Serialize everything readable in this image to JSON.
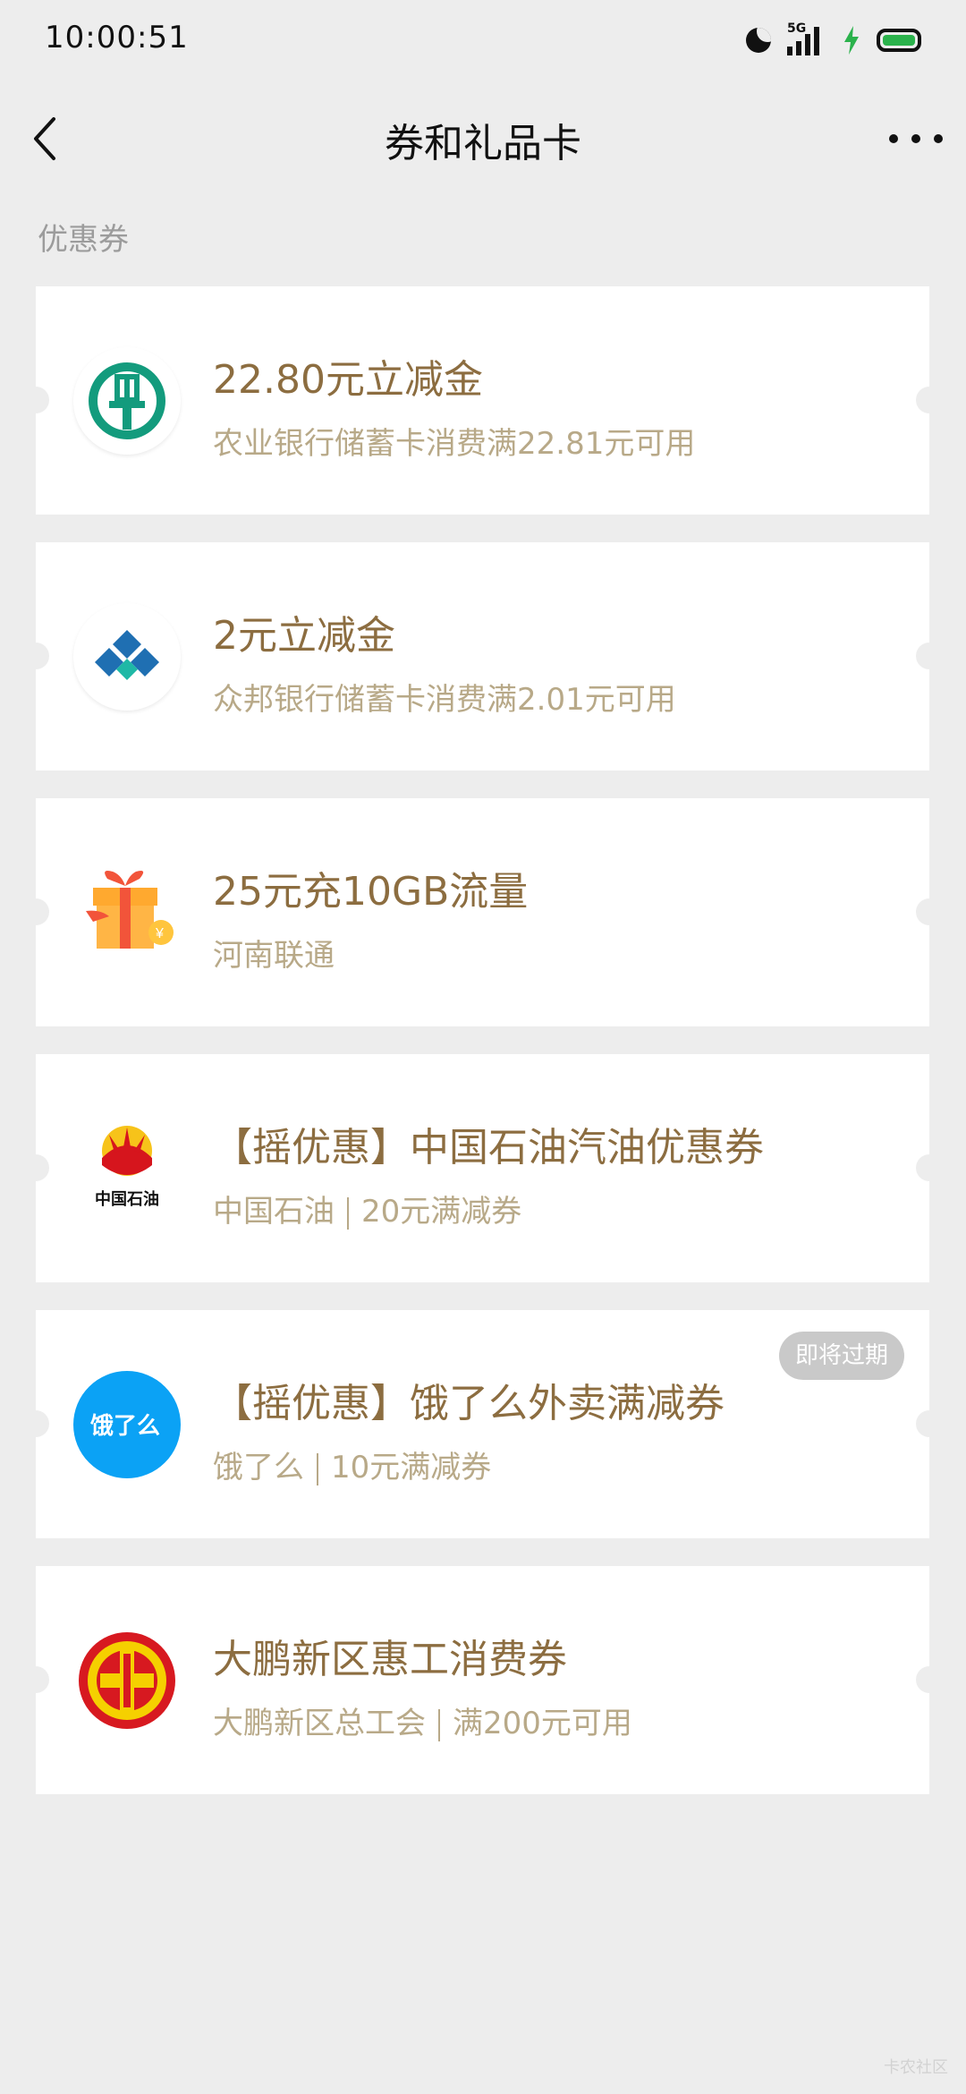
{
  "status_bar": {
    "time": "10:00:51",
    "network": "5G"
  },
  "nav": {
    "title": "券和礼品卡"
  },
  "section": {
    "title": "优惠券"
  },
  "coupons": [
    {
      "title": "22.80元立减金",
      "subtitle": "农业银行储蓄卡消费满22.81元可用",
      "logo": "abc-bank-logo"
    },
    {
      "title": "2元立减金",
      "subtitle": "众邦银行储蓄卡消费满2.01元可用",
      "logo": "zhongbang-bank-logo"
    },
    {
      "title": "25元充10GB流量",
      "subtitle": "河南联通",
      "logo": "gift-box-icon"
    },
    {
      "title": "【摇优惠】中国石油汽油优惠券",
      "sub_left": "中国石油",
      "sub_right": "20元满减券",
      "logo": "petrochina-logo",
      "logo_text": "中国石油"
    },
    {
      "title": "【摇优惠】饿了么外卖满减券",
      "sub_left": "饿了么",
      "sub_right": "10元满减券",
      "logo": "eleme-logo",
      "logo_text": "饿了么",
      "badge": "即将过期"
    },
    {
      "title": "大鹏新区惠工消费券",
      "sub_left": "大鹏新区总工会",
      "sub_right": "满200元可用",
      "logo": "trade-union-logo"
    }
  ],
  "watermark": "卡农社区",
  "colors": {
    "background": "#ededed",
    "card": "#ffffff",
    "title_gold": "#8c6d40",
    "subtitle_gold": "#b8a988",
    "abc_green": "#139b7d",
    "zhongbang_blue": "#1f6fb2",
    "zhongbang_teal": "#1fb8a6",
    "petrochina_red": "#d6151d",
    "petrochina_yellow": "#f7c31a",
    "eleme_blue": "#0ba2f5",
    "union_red": "#d71920",
    "union_yellow": "#f5d000",
    "battery_green": "#2bb24c"
  }
}
